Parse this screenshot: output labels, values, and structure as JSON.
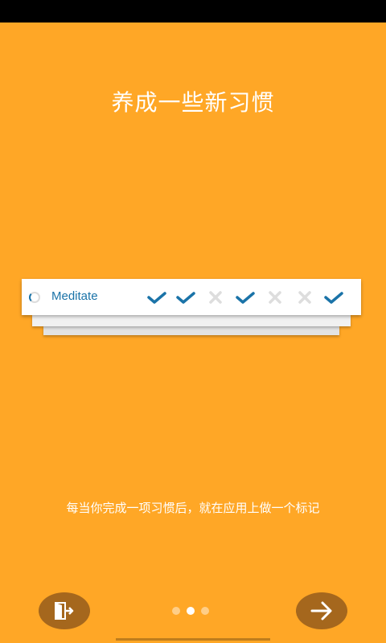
{
  "title": "养成一些新习惯",
  "habit": {
    "name": "Meditate",
    "days": [
      "check",
      "check",
      "cross",
      "check",
      "cross",
      "cross",
      "check"
    ]
  },
  "description": "每当你完成一项习惯后，就在应用上做一个标记",
  "pager": {
    "page_count": 3,
    "current_page": 2
  },
  "buttons": {
    "left_icon": "exit-door-icon",
    "right_icon": "arrow-right-icon"
  },
  "colors": {
    "background": "#FFA726",
    "accent": "#1A73A8",
    "button_bg": "#A5671D",
    "cross": "#DDDDDD"
  }
}
